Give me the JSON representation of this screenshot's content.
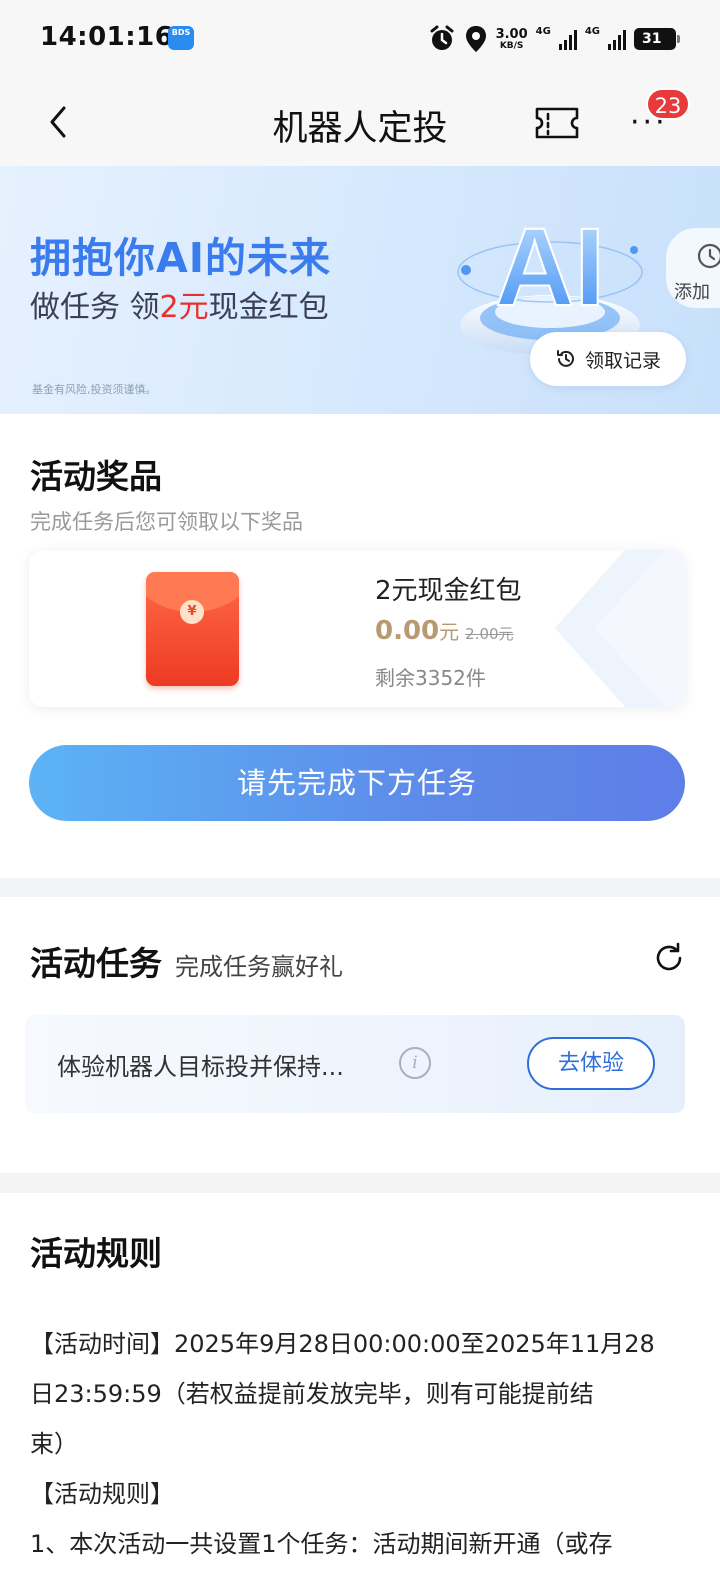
{
  "status_bar": {
    "time": "14:01:16",
    "app_badge": "BDS",
    "net_speed": "3.00",
    "net_speed_unit": "KB/S",
    "net_type_1": "4G",
    "net_type_2": "4G",
    "battery": "31"
  },
  "nav": {
    "title": "机器人定投",
    "badge_count": "23",
    "more": "···"
  },
  "banner": {
    "title": "拥抱你AI的未来",
    "subtitle_pre": "做任务 领",
    "subtitle_highlight": "2元",
    "subtitle_post": "现金红包",
    "note": "基金有风险,投资须谨慎。",
    "record_button": "领取记录",
    "add_label": "添加",
    "ai_text": "AI"
  },
  "prize_section": {
    "title": "活动奖品",
    "subtitle": "完成任务后您可领取以下奖品",
    "prize_name": "2元现金红包",
    "price": "0.00",
    "price_unit": "元",
    "original_price": "2.00元",
    "stock": "剩余3352件",
    "envelope_symbol": "¥",
    "main_button": "请先完成下方任务"
  },
  "task_section": {
    "title": "活动任务",
    "subtitle": "完成任务赢好礼",
    "task_text": "体验机器人目标投并保持...",
    "info_symbol": "i",
    "task_button": "去体验"
  },
  "rules_section": {
    "title": "活动规则",
    "lines": [
      "【活动时间】2025年9月28日00:00:00至2025年11月28",
      "日23:59:59（若权益提前发放完毕，则有可能提前结",
      "束）",
      "【活动规则】",
      "1、本次活动一共设置1个任务：活动期间新开通（或存"
    ]
  }
}
